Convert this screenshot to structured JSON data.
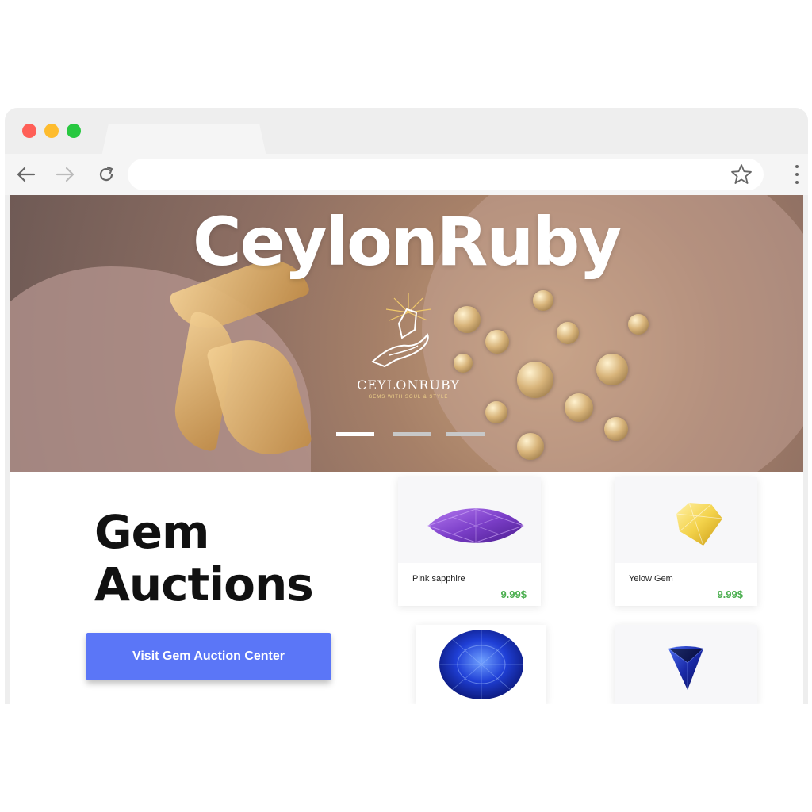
{
  "hero": {
    "title": "CeylonRuby",
    "logo_name": "CEYLONRUBY",
    "logo_tagline": "GEMS WITH SOUL & STYLE"
  },
  "main": {
    "headline_line1": "Gem",
    "headline_line2": "Auctions",
    "cta_label": "Visit Gem Auction Center"
  },
  "products": [
    {
      "name": "Pink sapphire",
      "price": "9.99$",
      "color": "#7c3fc9"
    },
    {
      "name": "Yelow Gem",
      "price": "9.99$",
      "color": "#f3d24a"
    },
    {
      "name": "",
      "price": "",
      "color": "#1f3fd6"
    },
    {
      "name": "",
      "price": "",
      "color": "#1a2aa8"
    }
  ],
  "colors": {
    "accent": "#5b76f7",
    "price": "#4caf50"
  }
}
